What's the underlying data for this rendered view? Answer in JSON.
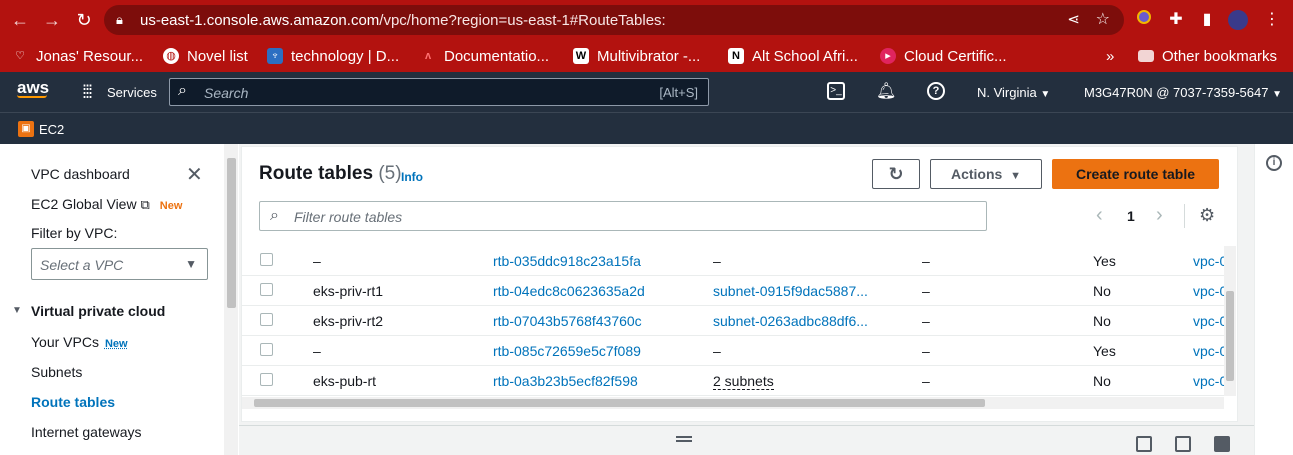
{
  "browser": {
    "url_host": "us-east-1.console.aws.amazon.com",
    "url_path": "/vpc/home?region=us-east-1#RouteTables:",
    "bookmarks": [
      {
        "label": "Jonas' Resour..."
      },
      {
        "label": "Novel list"
      },
      {
        "label": "technology | D..."
      },
      {
        "label": "Documentatio..."
      },
      {
        "label": "Multivibrator -..."
      },
      {
        "label": "Alt School Afri..."
      },
      {
        "label": "Cloud Certific..."
      }
    ],
    "more_label": "»",
    "other_bookmarks": "Other bookmarks"
  },
  "aws": {
    "logo": "aws",
    "services": "Services",
    "search_placeholder": "Search",
    "search_shortcut": "[Alt+S]",
    "region": "N. Virginia",
    "account": "M3G47R0N @ 7037-7359-5647",
    "service_crumb": "EC2"
  },
  "sidebar": {
    "dashboard": "VPC dashboard",
    "global_view": "EC2 Global View",
    "global_view_badge": "New",
    "filter_label": "Filter by VPC:",
    "filter_placeholder": "Select a VPC",
    "section": "Virtual private cloud",
    "items": [
      {
        "label": "Your VPCs",
        "badge": "New"
      },
      {
        "label": "Subnets"
      },
      {
        "label": "Route tables"
      },
      {
        "label": "Internet gateways"
      }
    ]
  },
  "main": {
    "title": "Route tables",
    "count": "(5)",
    "info": "Info",
    "actions": "Actions",
    "create": "Create route table",
    "filter_placeholder": "Filter route tables",
    "page": "1",
    "rows": [
      {
        "name": "–",
        "id": "rtb-035ddc918c23a15fa",
        "assoc": "–",
        "edge": "–",
        "main": "Yes",
        "vpc": "vpc-0"
      },
      {
        "name": "eks-priv-rt1",
        "id": "rtb-04edc8c0623635a2d",
        "assoc": "subnet-0915f9dac5887...",
        "edge": "–",
        "main": "No",
        "vpc": "vpc-0"
      },
      {
        "name": "eks-priv-rt2",
        "id": "rtb-07043b5768f43760c",
        "assoc": "subnet-0263adbc88df6...",
        "edge": "–",
        "main": "No",
        "vpc": "vpc-0"
      },
      {
        "name": "–",
        "id": "rtb-085c72659e5c7f089",
        "assoc": "–",
        "edge": "–",
        "main": "Yes",
        "vpc": "vpc-0"
      },
      {
        "name": "eks-pub-rt",
        "id": "rtb-0a3b23b5ecf82f598",
        "assoc": "2 subnets",
        "edge": "–",
        "main": "No",
        "vpc": "vpc-0"
      }
    ]
  },
  "colors": {
    "chrome": "#b3120f",
    "aws_nav": "#232f3e",
    "primary": "#ec7211",
    "link": "#0073bb"
  }
}
